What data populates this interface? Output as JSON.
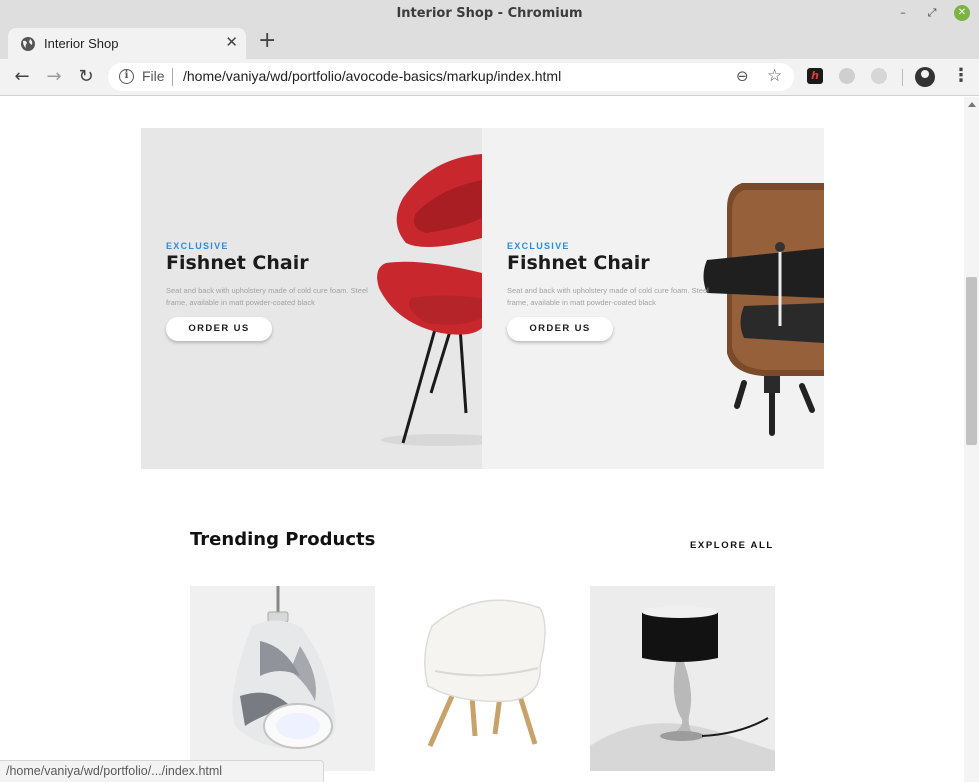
{
  "window": {
    "title": "Interior Shop - Chromium",
    "minimize_glyph": "–",
    "maximize_glyph": "⤢",
    "close_glyph": "✕"
  },
  "tabs": [
    {
      "title": "Interior Shop",
      "icon": "globe-icon",
      "close_glyph": "✕"
    }
  ],
  "new_tab_glyph": "+",
  "toolbar": {
    "back_glyph": "←",
    "forward_glyph": "→",
    "reload_glyph": "↻",
    "info_glyph": "i",
    "scheme_label": "File",
    "url": "/home/vaniya/wd/portfolio/avocode-basics/markup/index.html",
    "zoom_glyph": "⊖",
    "bookmark_glyph": "☆",
    "extension_label": "h",
    "menu_glyph": "⋮"
  },
  "promos": [
    {
      "tag": "EXCLUSIVE",
      "name": "Fishnet Chair",
      "description": "Seat and back with upholstery made of cold cure foam. Steel frame, available in matt powder-coated black",
      "button": "ORDER US",
      "image": "red-shell-chair"
    },
    {
      "tag": "EXCLUSIVE",
      "name": "Fishnet Chair",
      "description": "Seat and back with upholstery made of cold cure foam. Steel frame, available in matt powder-coated black",
      "button": "ORDER US",
      "image": "leather-lounge-chair"
    }
  ],
  "trending": {
    "title": "Trending Products",
    "explore_label": "EXPLORE ALL",
    "products": [
      {
        "image": "marble-pendant-lamp"
      },
      {
        "image": "white-shell-chair"
      },
      {
        "image": "black-shade-table-lamp"
      }
    ]
  },
  "status_bar": "/home/vaniya/wd/portfolio/.../index.html",
  "colors": {
    "accent": "#2d8cdb",
    "heading": "#1c1c1c",
    "chrome": "#dedede"
  }
}
